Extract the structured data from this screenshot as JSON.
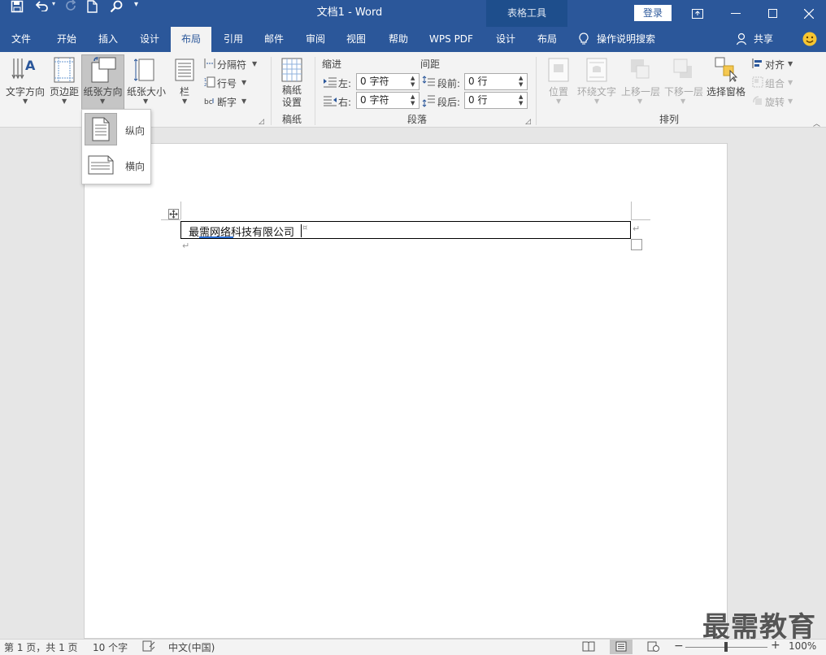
{
  "titlebar": {
    "doc_title": "文档1  -  Word",
    "context_tools": "表格工具",
    "signin": "登录"
  },
  "tabs": [
    "文件",
    "开始",
    "插入",
    "设计",
    "布局",
    "引用",
    "邮件",
    "审阅",
    "视图",
    "帮助",
    "WPS PDF",
    "设计",
    "布局"
  ],
  "active_tab": "布局",
  "tell_me": "操作说明搜索",
  "share": "共享",
  "ribbon": {
    "page_setup": {
      "text_direction": "文字方向",
      "margins": "页边距",
      "orientation": "纸张方向",
      "size": "纸张大小",
      "columns": "栏",
      "breaks": "分隔符",
      "line_numbers": "行号",
      "hyphenation": "断字"
    },
    "manuscript": {
      "button": "稿纸设置",
      "button_line1": "稿纸",
      "button_line2": "设置",
      "group": "稿纸"
    },
    "paragraph": {
      "indent_title": "缩进",
      "spacing_title": "间距",
      "left_label": "左:",
      "right_label": "右:",
      "before_label": "段前:",
      "after_label": "段后:",
      "left_value": "0 字符",
      "right_value": "0 字符",
      "before_value": "0 行",
      "after_value": "0 行",
      "group": "段落"
    },
    "arrange": {
      "position": "位置",
      "wrap_text": "环绕文字",
      "bring_forward": "上移一层",
      "send_backward": "下移一层",
      "selection_pane": "选择窗格",
      "align": "对齐",
      "group_btn": "组合",
      "rotate": "旋转",
      "group": "排列"
    }
  },
  "orientation_menu": {
    "portrait": "纵向",
    "landscape": "横向"
  },
  "document": {
    "table_cell_text": "最需网络科技有限公司"
  },
  "statusbar": {
    "page": "第 1 页，共 1 页",
    "words": "10 个字",
    "language": "中文(中国)",
    "zoom": "100%"
  },
  "watermark": "最需教育",
  "colors": {
    "brand": "#2b579a",
    "context": "#1e4e8c",
    "ribbon": "#f3f3f3",
    "canvas": "#e6e6e6"
  }
}
